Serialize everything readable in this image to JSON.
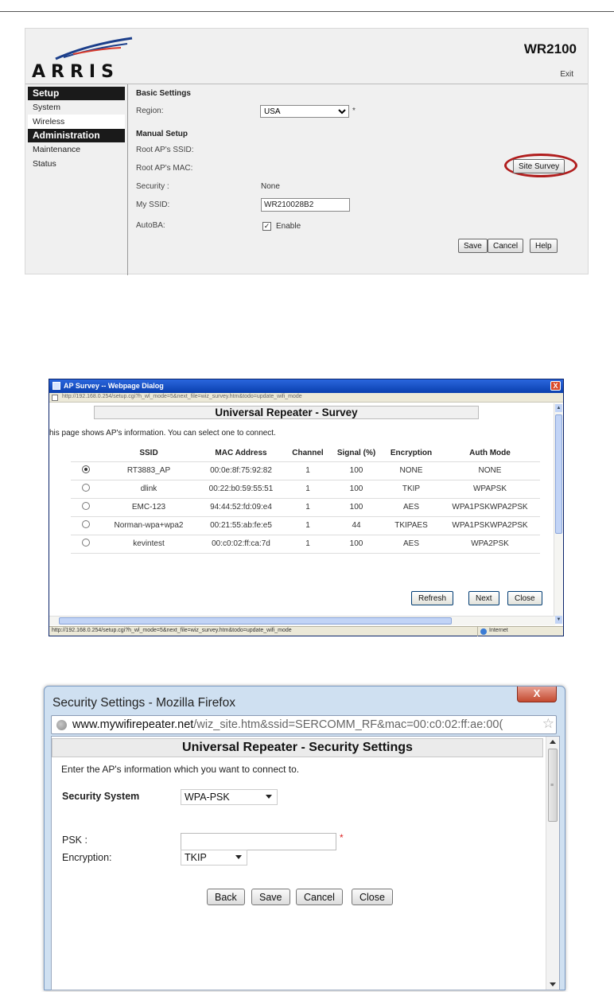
{
  "router": {
    "brand": "ARRIS",
    "model": "WR2100",
    "exit": "Exit",
    "sidebar": [
      {
        "label": "Setup",
        "type": "header"
      },
      {
        "label": "System",
        "type": "item"
      },
      {
        "label": "Wireless",
        "type": "item",
        "active": true
      },
      {
        "label": "Administration",
        "type": "header"
      },
      {
        "label": "Maintenance",
        "type": "item"
      },
      {
        "label": "Status",
        "type": "item"
      }
    ],
    "basic_settings": "Basic Settings",
    "region_label": "Region:",
    "region_value": "USA",
    "required_mark": "*",
    "manual_setup": "Manual Setup",
    "root_ssid_label": "Root AP's SSID:",
    "root_mac_label": "Root AP's MAC:",
    "site_survey": "Site Survey",
    "security_label": "Security :",
    "security_value": "None",
    "my_ssid_label": "My SSID:",
    "my_ssid_value": "WR210028B2",
    "autoba_label": "AutoBA:",
    "autoba_check": "✓",
    "autoba_enable": "Enable",
    "buttons": {
      "save": "Save",
      "cancel": "Cancel",
      "help": "Help"
    },
    "highlight_color": "#b01c1c"
  },
  "survey": {
    "window_title": "AP Survey -- Webpage Dialog",
    "address": "http://192.168.0.254/setup.cgi?h_wl_mode=5&next_file=wiz_survey.htm&todo=update_wifi_mode",
    "heading": "Universal Repeater - Survey",
    "intro": "his page shows AP's information. You can select one to connect.",
    "columns": [
      "SSID",
      "MAC Address",
      "Channel",
      "Signal (%)",
      "Encryption",
      "Auth Mode"
    ],
    "rows": [
      {
        "selected": true,
        "ssid": "RT3883_AP",
        "mac": "00:0e:8f:75:92:82",
        "channel": "1",
        "signal": "100",
        "encryption": "NONE",
        "auth": "NONE"
      },
      {
        "selected": false,
        "ssid": "dlink",
        "mac": "00:22:b0:59:55:51",
        "channel": "1",
        "signal": "100",
        "encryption": "TKIP",
        "auth": "WPAPSK"
      },
      {
        "selected": false,
        "ssid": "EMC-123",
        "mac": "94:44:52:fd:09:e4",
        "channel": "1",
        "signal": "100",
        "encryption": "AES",
        "auth": "WPA1PSKWPA2PSK"
      },
      {
        "selected": false,
        "ssid": "Norman-wpa+wpa2",
        "mac": "00:21:55:ab:fe:e5",
        "channel": "1",
        "signal": "44",
        "encryption": "TKIPAES",
        "auth": "WPA1PSKWPA2PSK"
      },
      {
        "selected": false,
        "ssid": "kevintest",
        "mac": "00:c0:02:ff:ca:7d",
        "channel": "1",
        "signal": "100",
        "encryption": "AES",
        "auth": "WPA2PSK"
      }
    ],
    "buttons": {
      "refresh": "Refresh",
      "next": "Next",
      "close": "Close"
    },
    "status_url": "http://192.168.0.254/setup.cgi?h_wl_mode=5&next_file=wiz_survey.htm&todo=update_wifi_mode",
    "status_zone": "Internet",
    "close_glyph": "X"
  },
  "security": {
    "window_title": "Security Settings - Mozilla Firefox",
    "close_glyph": "X",
    "url_domain": "www.mywifirepeater.net",
    "url_path": "/wiz_site.htm&ssid=SERCOMM_RF&mac=00:c0:02:ff:ae:00(",
    "star": "☆",
    "heading": "Universal Repeater - Security Settings",
    "intro": "Enter the AP's information which you want to connect to.",
    "security_system_label": "Security System",
    "security_system_value": "WPA-PSK",
    "psk_label": "PSK :",
    "psk_value": "",
    "required_mark": "*",
    "encryption_label": "Encryption:",
    "encryption_value": "TKIP",
    "buttons": {
      "back": "Back",
      "save": "Save",
      "cancel": "Cancel",
      "close": "Close"
    },
    "grip": "≡"
  }
}
